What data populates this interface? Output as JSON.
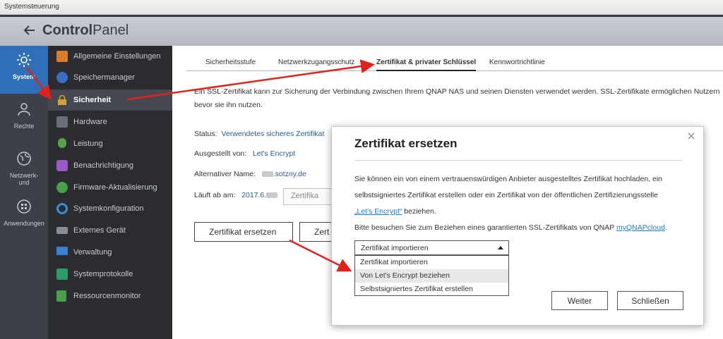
{
  "system_bar": {
    "title": "Systemsteuerung"
  },
  "header": {
    "title_bold": "Control",
    "title_rest": "Panel"
  },
  "icon_column": [
    {
      "label": "System",
      "icon": "gear-icon",
      "active": true
    },
    {
      "label": "Rechte",
      "icon": "user-icon",
      "active": false
    },
    {
      "label": "Netzwerk-\nund",
      "icon": "globe-icon",
      "active": false
    },
    {
      "label": "Anwendungen",
      "icon": "apps-icon",
      "active": false
    }
  ],
  "menu": [
    {
      "label": "Allgemeine Einstellungen",
      "icon": "settings-doc-icon",
      "color": "#d97c2b"
    },
    {
      "label": "Speichermanager",
      "icon": "storage-icon",
      "color": "#3b6fc4"
    },
    {
      "label": "Sicherheit",
      "icon": "lock-icon",
      "color": "#d0a23a",
      "active": true
    },
    {
      "label": "Hardware",
      "icon": "hardware-icon",
      "color": "#6b6e76"
    },
    {
      "label": "Leistung",
      "icon": "power-icon",
      "color": "#5ba34a"
    },
    {
      "label": "Benachrichtigung",
      "icon": "chat-icon",
      "color": "#9b59c8"
    },
    {
      "label": "Firmware-Aktualisierung",
      "icon": "firmware-icon",
      "color": "#48a048"
    },
    {
      "label": "Systemkonfiguration",
      "icon": "config-icon",
      "color": "#3a8ed8"
    },
    {
      "label": "Externes Gerät",
      "icon": "external-device-icon",
      "color": "#8a8d93"
    },
    {
      "label": "Verwaltung",
      "icon": "monitor-icon",
      "color": "#3a7fd0"
    },
    {
      "label": "Systemprotokolle",
      "icon": "log-icon",
      "color": "#2d9a6a"
    },
    {
      "label": "Ressourcenmonitor",
      "icon": "resource-monitor-icon",
      "color": "#4aa04a"
    }
  ],
  "tabs": [
    {
      "label": "Sicherheitsstufe"
    },
    {
      "label": "Netzwerkzugangsschutz"
    },
    {
      "label": "Zertifikat & privater Schlüssel",
      "active": true
    },
    {
      "label": "Kennwortrichtlinie"
    }
  ],
  "content": {
    "description_line1": "Ein SSL-Zertifikat kann zur Sicherung der Verbindung zwischen Ihrem QNAP NAS und seinen Diensten verwendet werden. SSL-Zertifikate ermöglichen Nutzern",
    "description_line2": "bevor sie ihn nutzen.",
    "status_label": "Status:",
    "status_value": "Verwendetes sicheres Zertifikat",
    "issued_label": "Ausgestellt von:",
    "issued_value": "Let's Encrypt",
    "altname_label": "Alternativer Name:",
    "altname_value": ".sotzny.de",
    "expires_label": "Läuft ab am:",
    "expires_value": "2017.6.",
    "partial_button": "Zertifika",
    "replace_button": "Zertifikat ersetzen",
    "second_button_partial": "Zert"
  },
  "modal": {
    "title": "Zertifikat ersetzen",
    "text_line1": "Sie können ein von einem vertrauenswürdigen Anbieter ausgestelltes Zertifikat hochladen, ein",
    "text_line2": "selbstsigniertes Zertifikat erstellen oder ein Zertifikat von der öffentlichen Zertifizierungsstelle",
    "text_link": "„Let's Encrypt“",
    "text_line3_rest": " beziehen.",
    "hint_text": "Bitte besuchen Sie zum Beziehen eines garantierten SSL-Zertifikats von QNAP ",
    "hint_link": "myQNAPcloud",
    "hint_end": ".",
    "select_value": "Zertifikat importieren",
    "options": [
      {
        "label": "Zertifikat importieren"
      },
      {
        "label": "Von Let's Encrypt beziehen",
        "hover": true
      },
      {
        "label": "Selbstsigniertes Zertifikat erstellen"
      }
    ],
    "next_button": "Weiter",
    "close_button": "Schließen"
  },
  "colors": {
    "accent": "#2f6fb7",
    "arrow": "#e0221b",
    "link": "#1e7bd6"
  }
}
